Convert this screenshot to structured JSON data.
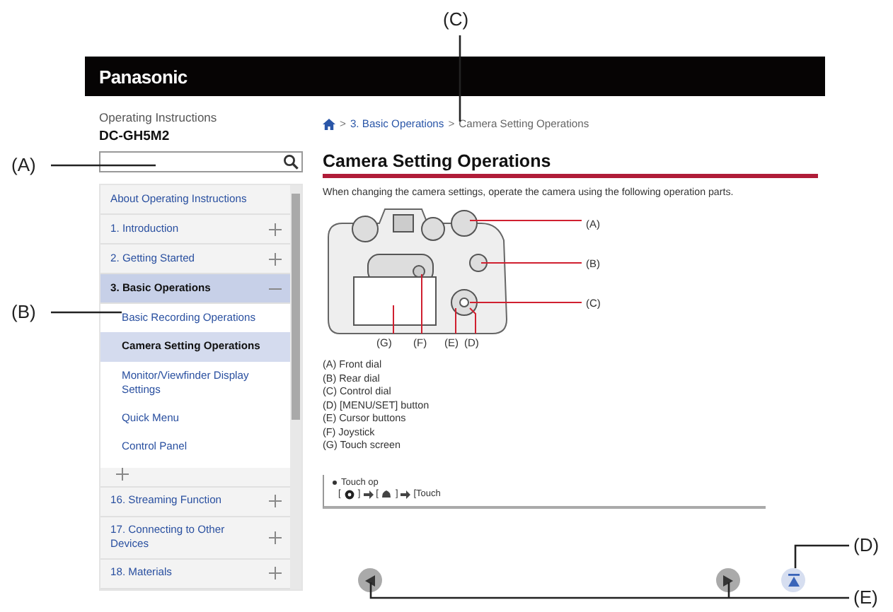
{
  "callouts": [
    "(A)",
    "(B)",
    "(C)",
    "(D)",
    "(E)"
  ],
  "header": {
    "logo": "Panasonic"
  },
  "sidebar": {
    "subtitle": "Operating Instructions",
    "model": "DC-GH5M2",
    "nav": [
      {
        "label": "About Operating Instructions",
        "kind": "link",
        "selected": false
      },
      {
        "label": "1. Introduction",
        "kind": "chapter",
        "expanded": false,
        "selected": false
      },
      {
        "label": "2. Getting Started",
        "kind": "chapter",
        "expanded": false,
        "selected": false
      },
      {
        "label": "3. Basic Operations",
        "kind": "chapter",
        "expanded": true,
        "selected": true,
        "children": [
          {
            "label": "Basic Recording Operations",
            "selected": false
          },
          {
            "label": "Camera Setting Operations",
            "selected": true
          },
          {
            "label": "Monitor/Viewfinder Display Settings",
            "selected": false
          },
          {
            "label": "Quick Menu",
            "selected": false
          },
          {
            "label": "Control Panel",
            "selected": false
          }
        ]
      }
    ],
    "nav_after_cut": [
      {
        "kind": "chapter",
        "expanded": false,
        "selected": false
      },
      {
        "label": "16. Streaming Function",
        "kind": "chapter",
        "expanded": false,
        "selected": false
      },
      {
        "label": "17. Connecting to Other Devices",
        "kind": "chapter",
        "expanded": false,
        "selected": false
      },
      {
        "label": "18. Materials",
        "kind": "chapter",
        "expanded": false,
        "selected": false
      }
    ]
  },
  "content": {
    "breadcrumb_separator": ">",
    "breadcrumb": [
      {
        "kind": "home"
      },
      {
        "kind": "link",
        "label": "3. Basic Operations"
      },
      {
        "kind": "current",
        "label": "Camera Setting Operations"
      }
    ],
    "title": "Camera Setting Operations",
    "intro": "When changing the camera settings, operate the camera using the following operation parts.",
    "figure_labels": [
      "(A)",
      "(B)",
      "(C)",
      "(G)",
      "(F)",
      "(E)",
      "(D)"
    ],
    "legend": [
      "(A) Front dial",
      "(B) Rear dial",
      "(C) Control dial",
      "(D) [MENU/SET] button",
      "(E) Cursor buttons",
      "(F) Joystick",
      "(G) Touch screen"
    ],
    "touch_box": {
      "bullet": "Touch op",
      "open": "[",
      "close": "]",
      "last": "[Touch"
    }
  }
}
